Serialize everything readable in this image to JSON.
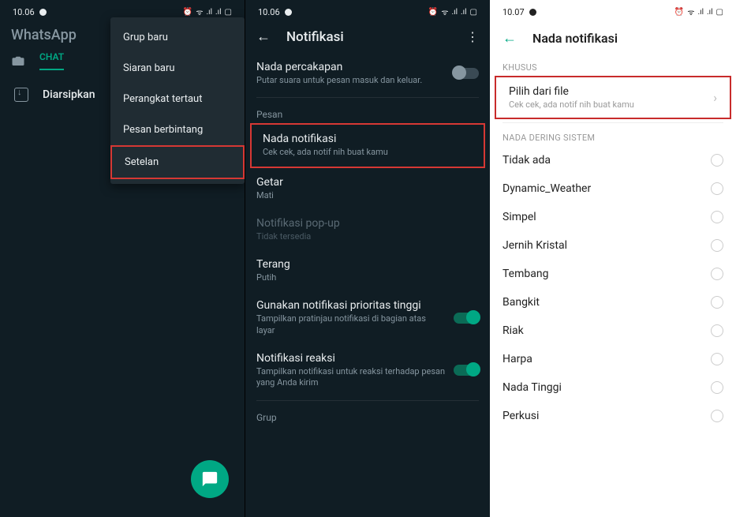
{
  "status": {
    "time_a": "10.06",
    "time_b": "10.07",
    "icons": "ᯤ ⇵ .ıl .ıl 🔋"
  },
  "panel1": {
    "app_name": "WhatsApp",
    "tab_chat": "CHAT",
    "archived": "Diarsipkan",
    "menu": {
      "grup_baru": "Grup baru",
      "siaran_baru": "Siaran baru",
      "perangkat": "Perangkat tertaut",
      "pesan_bintang": "Pesan berbintang",
      "setelan": "Setelan"
    }
  },
  "panel2": {
    "title": "Notifikasi",
    "tone_title": "Nada percakapan",
    "tone_sub": "Putar suara untuk pesan masuk dan keluar.",
    "section_pesan": "Pesan",
    "notif_title": "Nada notifikasi",
    "notif_sub": "Cek cek, ada notif nih buat kamu",
    "getar_title": "Getar",
    "getar_sub": "Mati",
    "popup_title": "Notifikasi pop-up",
    "popup_sub": "Tidak tersedia",
    "terang_title": "Terang",
    "terang_sub": "Putih",
    "priority_title": "Gunakan notifikasi prioritas tinggi",
    "priority_sub": "Tampilkan pratinjau notifikasi di bagian atas layar",
    "reaction_title": "Notifikasi reaksi",
    "reaction_sub": "Tampilkan notifikasi untuk reaksi terhadap pesan yang Anda kirim",
    "section_grup": "Grup"
  },
  "panel3": {
    "title": "Nada notifikasi",
    "section_khusus": "KHUSUS",
    "file_title": "Pilih dari file",
    "file_sub": "Cek cek, ada notif nih buat kamu",
    "section_sistem": "NADA DERING SISTEM",
    "ringtones": {
      "r0": "Tidak ada",
      "r1": "Dynamic_Weather",
      "r2": "Simpel",
      "r3": "Jernih Kristal",
      "r4": "Tembang",
      "r5": "Bangkit",
      "r6": "Riak",
      "r7": "Harpa",
      "r8": "Nada Tinggi",
      "r9": "Perkusi"
    }
  }
}
